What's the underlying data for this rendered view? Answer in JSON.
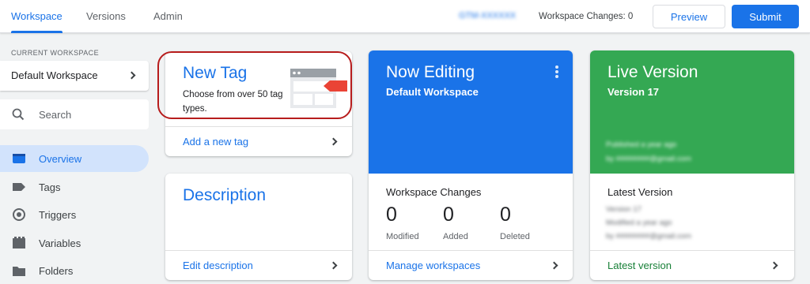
{
  "topbar": {
    "tabs": [
      {
        "label": "Workspace",
        "active": true
      },
      {
        "label": "Versions",
        "active": false
      },
      {
        "label": "Admin",
        "active": false
      }
    ],
    "account_id": "GTM-XXXXXX",
    "workspace_changes": "Workspace Changes: 0",
    "preview_label": "Preview",
    "submit_label": "Submit"
  },
  "sidebar": {
    "current_workspace_label": "CURRENT WORKSPACE",
    "workspace_name": "Default Workspace",
    "search_label": "Search",
    "items": [
      {
        "label": "Overview",
        "icon": "overview-icon",
        "active": true
      },
      {
        "label": "Tags",
        "icon": "tag-icon",
        "active": false
      },
      {
        "label": "Triggers",
        "icon": "trigger-icon",
        "active": false
      },
      {
        "label": "Variables",
        "icon": "variable-icon",
        "active": false
      },
      {
        "label": "Folders",
        "icon": "folder-icon",
        "active": false
      }
    ]
  },
  "new_tag_card": {
    "title": "New Tag",
    "description": "Choose from over 50 tag types.",
    "link": "Add a new tag"
  },
  "description_card": {
    "title": "Description",
    "link": "Edit description"
  },
  "now_editing_card": {
    "title": "Now Editing",
    "subtitle": "Default Workspace",
    "section_title": "Workspace Changes",
    "stats": [
      {
        "value": "0",
        "label": "Modified"
      },
      {
        "value": "0",
        "label": "Added"
      },
      {
        "value": "0",
        "label": "Deleted"
      }
    ],
    "link": "Manage workspaces"
  },
  "live_version_card": {
    "title": "Live Version",
    "subtitle": "Version 17",
    "blurred_line_1": "Published a year ago",
    "blurred_line_2": "by ########@gmail.com",
    "section_title": "Latest Version",
    "blurred_latest_1": "Version 17",
    "blurred_latest_2": "Modified a year ago",
    "blurred_latest_3": "by ########@gmail.com",
    "link": "Latest version"
  },
  "colors": {
    "brand_blue": "#1a73e8",
    "editing_blue": "#1a73e8",
    "live_green": "#34a853",
    "highlight_red": "#b71c1c"
  }
}
